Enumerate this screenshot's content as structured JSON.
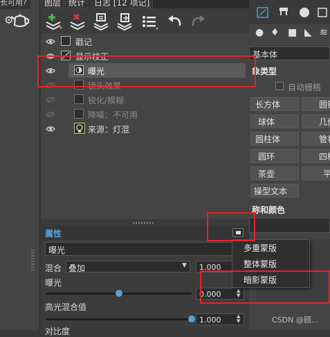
{
  "left": {
    "label": "长可用?"
  },
  "tabs": [
    {
      "label": "图层"
    },
    {
      "label": "统计"
    },
    {
      "label": "日志 [12 项记]"
    }
  ],
  "toolbar": {
    "buttons": [
      {
        "name": "add-layer-button",
        "icon": "add-layer-icon"
      },
      {
        "name": "delete-layer-button",
        "icon": "delete-layer-icon"
      },
      {
        "name": "stamp-layer-button",
        "icon": "stamp-icon"
      },
      {
        "name": "export-layer-button",
        "icon": "export-icon"
      },
      {
        "name": "list-menu-button",
        "icon": "list-icon"
      },
      {
        "name": "undo-button",
        "icon": "undo-icon"
      },
      {
        "name": "redo-button",
        "icon": "redo-icon"
      }
    ]
  },
  "layers": [
    {
      "label": "戳记",
      "visible": true,
      "indent": 0,
      "dim": false
    },
    {
      "label": "显示校正",
      "visible": true,
      "indent": 0,
      "dim": false
    },
    {
      "label": "曝光",
      "visible": true,
      "indent": 1,
      "dim": false,
      "selected": true
    },
    {
      "label": "镜头效果",
      "visible": false,
      "indent": 1,
      "dim": true
    },
    {
      "label": "锐化/模糊",
      "visible": false,
      "indent": 1,
      "dim": true
    },
    {
      "label": "降噪：不可用",
      "visible": false,
      "indent": 1,
      "dim": true
    },
    {
      "label": "来源：灯混",
      "visible": true,
      "indent": 1,
      "dim": false
    }
  ],
  "props": {
    "header": "属性",
    "layer_name": "曝光",
    "blend_label": "混合",
    "blend_value": "叠加",
    "blend_amount": "1.000",
    "exposure_label": "曝光",
    "exposure_value": "0.000",
    "exposure_level": 0.5,
    "highlight_label": "高光混合值",
    "highlight_value": "1.000",
    "highlight_level": 1.0,
    "contrast_label": "对比度"
  },
  "right": {
    "object_label": "基本体",
    "section_type": "象类型",
    "autogrid": "自动栅格",
    "buttons": [
      [
        "长方体",
        "圆锥"
      ],
      [
        "球体",
        "几何"
      ],
      [
        "圆柱体",
        "管状"
      ],
      [
        "圆环",
        "四棱"
      ],
      [
        "茶壶",
        "平"
      ],
      [
        "操型文本"
      ]
    ],
    "section_name": "称和颜色"
  },
  "menu": {
    "items": [
      "多重蒙版",
      "整体蒙版",
      "暗影蒙版"
    ]
  },
  "watermark": "CSDN @顾..."
}
